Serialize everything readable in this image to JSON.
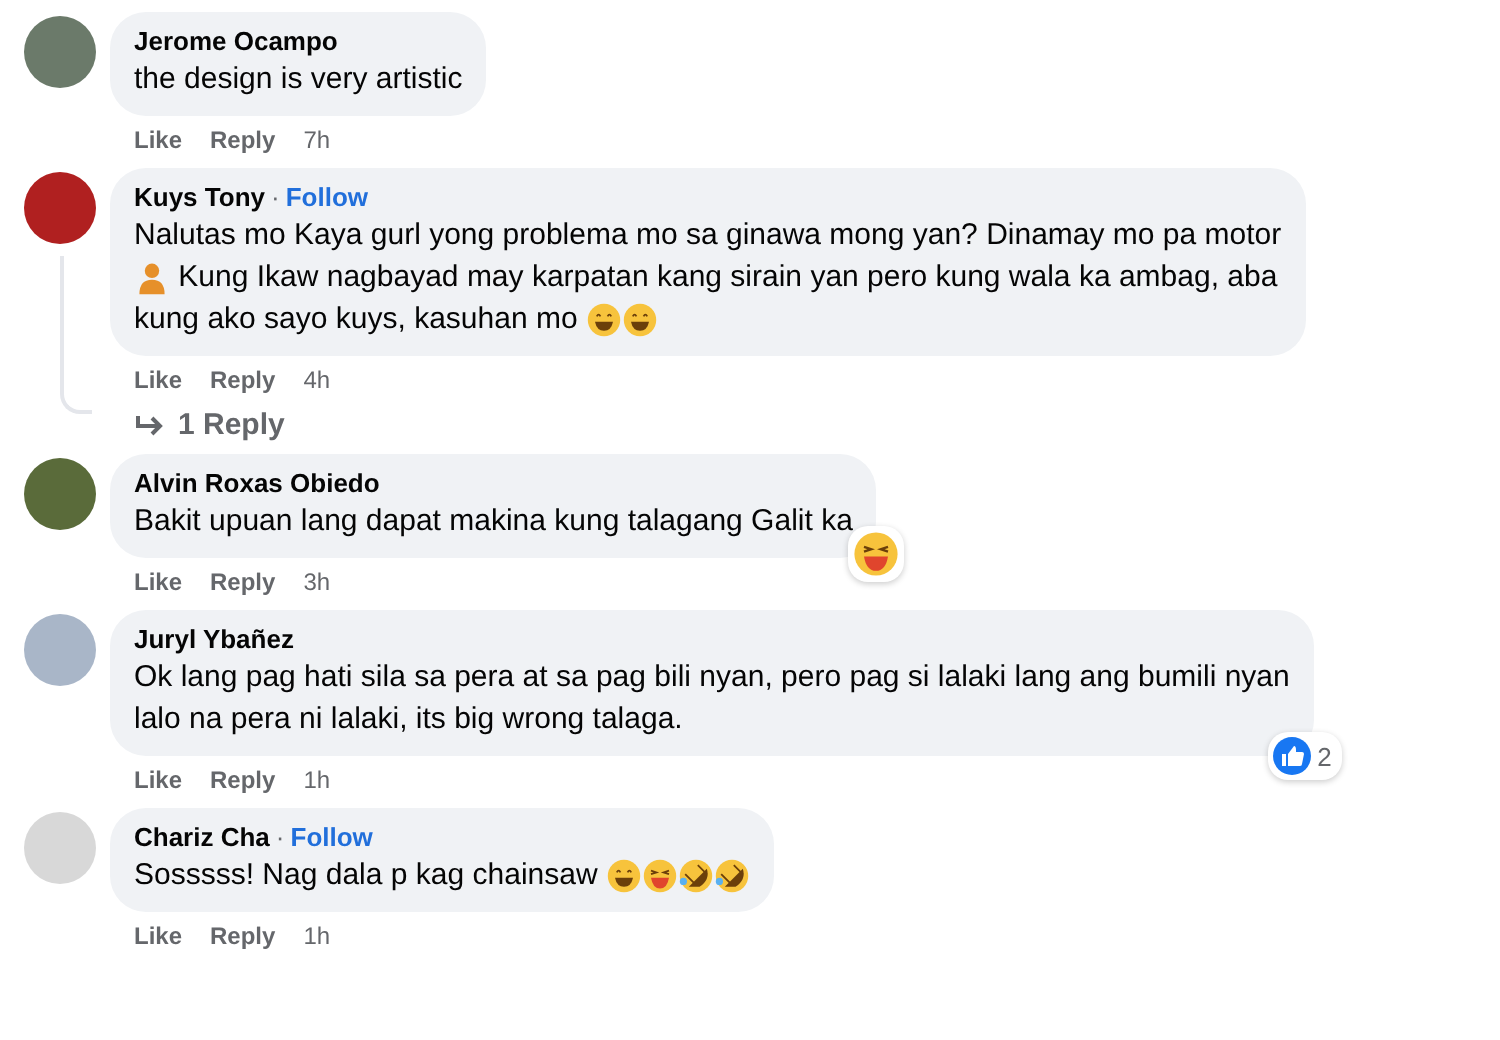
{
  "comments": [
    {
      "author": "Jerome Ocampo",
      "lines": [
        [
          {
            "kind": "text",
            "text": "the design is very artistic"
          }
        ]
      ],
      "actions": {
        "like": "Like",
        "reply": "Reply",
        "time": "7h"
      }
    },
    {
      "author": "Kuys Tony",
      "separator": "·",
      "follow": "Follow",
      "lines": [
        [
          {
            "kind": "text",
            "text": "Nalutas mo Kaya gurl yong problema mo sa ginawa mong yan? Dinamay mo pa motor"
          }
        ],
        [
          {
            "kind": "person"
          },
          {
            "kind": "text",
            "text": " Kung Ikaw nagbayad may karpatan kang sirain yan pero kung wala ka ambag, aba"
          }
        ],
        [
          {
            "kind": "text",
            "text": "kung ako sayo kuys, kasuhan mo "
          },
          {
            "kind": "grin"
          },
          {
            "kind": "grin"
          }
        ]
      ],
      "actions": {
        "like": "Like",
        "reply": "Reply",
        "time": "4h"
      },
      "replies": "1 Reply"
    },
    {
      "author": "Alvin Roxas Obiedo",
      "lines": [
        [
          {
            "kind": "text",
            "text": "Bakit upuan lang dapat makina kung talagang Galit ka"
          }
        ]
      ],
      "actions": {
        "like": "Like",
        "reply": "Reply",
        "time": "3h"
      },
      "reactions": [
        {
          "kind": "laugh"
        }
      ]
    },
    {
      "author": "Juryl Ybañez",
      "lines": [
        [
          {
            "kind": "text",
            "text": "Ok lang pag hati sila sa pera at sa pag bili nyan, pero pag si lalaki lang ang bumili nyan"
          }
        ],
        [
          {
            "kind": "text",
            "text": "lalo na pera ni lalaki, its big wrong talaga."
          }
        ]
      ],
      "actions": {
        "like": "Like",
        "reply": "Reply",
        "time": "1h"
      },
      "reactions": [
        {
          "kind": "like"
        }
      ],
      "reaction_count": "2"
    },
    {
      "author": "Chariz Cha",
      "separator": "·",
      "follow": "Follow",
      "lines": [
        [
          {
            "kind": "text",
            "text": "Sosssss! Nag dala p kag chainsaw "
          },
          {
            "kind": "grin"
          },
          {
            "kind": "laugh"
          },
          {
            "kind": "rofl"
          },
          {
            "kind": "rofl"
          }
        ]
      ],
      "actions": {
        "like": "Like",
        "reply": "Reply",
        "time": "1h"
      }
    }
  ]
}
